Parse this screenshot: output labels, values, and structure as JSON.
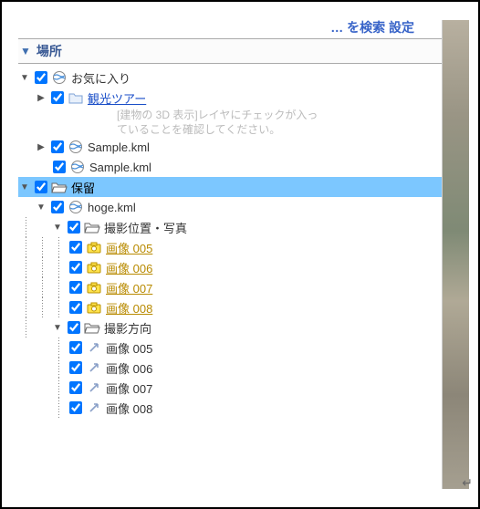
{
  "header": {
    "top_cut_text": "… を検索   設定",
    "panel_title": "場所"
  },
  "tree": {
    "favorites": {
      "label": "お気に入り",
      "kanko_tour": "観光ツアー",
      "hint_line1": "[建物の 3D 表示]レイヤにチェックが入っ",
      "hint_line2": "ていることを確認してください。",
      "sample1": "Sample.kml",
      "sample2": "Sample.kml"
    },
    "pending": {
      "label": "保留",
      "hoge": "hoge.kml",
      "shoot_pos": {
        "label": "撮影位置・写真",
        "images": [
          "画像 005",
          "画像 006",
          "画像 007",
          "画像 008"
        ]
      },
      "shoot_dir": {
        "label": "撮影方向",
        "images": [
          "画像 005",
          "画像 006",
          "画像 007",
          "画像 008"
        ]
      }
    }
  }
}
